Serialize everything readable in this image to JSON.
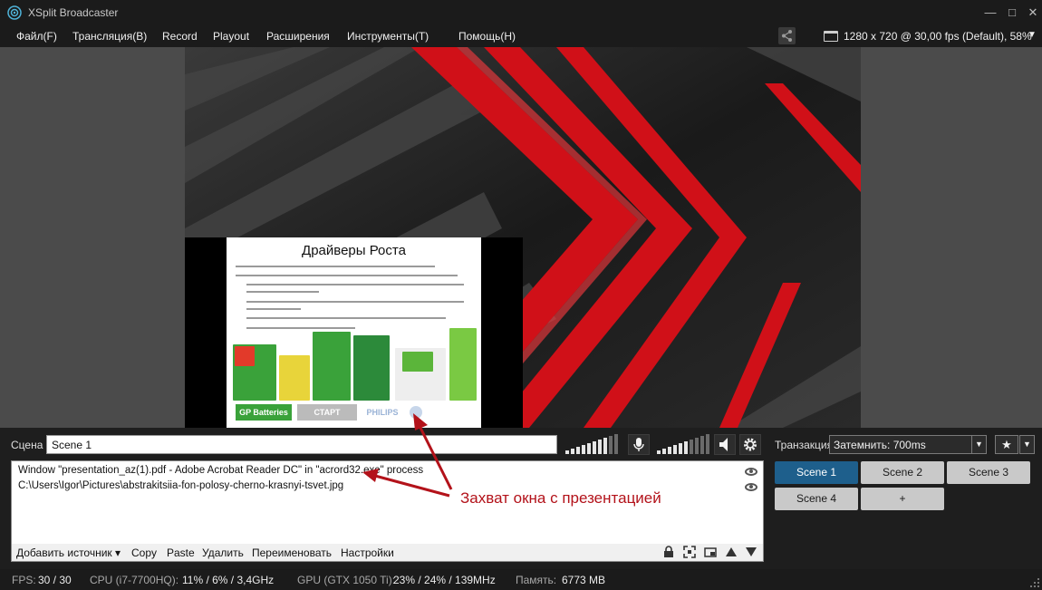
{
  "window": {
    "title": "XSplit Broadcaster",
    "minimize": "—",
    "maximize": "□",
    "close": "✕"
  },
  "menu": {
    "items": [
      "Файл(F)",
      "Трансляция(B)",
      "Record",
      "Playout",
      "Расширения",
      "Инструменты(T)",
      "Помощь(H)"
    ],
    "resolution": "1280 x 720 @ 30,00 fps (Default), 58%"
  },
  "slide": {
    "title": "Драйверы Роста",
    "logos": [
      "GP Batteries",
      "СТАРТ",
      "PHILIPS"
    ]
  },
  "scene": {
    "label": "Сцена",
    "name": "Scene 1"
  },
  "sources": [
    {
      "text": "Window \"presentation_az(1).pdf - Adobe Acrobat Reader DC\" in \"acrord32.exe\" process"
    },
    {
      "text": "C:\\Users\\Igor\\Pictures\\abstrakitsiia-fon-polosy-cherno-krasnyi-tsvet.jpg"
    }
  ],
  "source_toolbar": {
    "add_source": "Добавить источник ▾",
    "copy": "Copy",
    "paste": "Paste",
    "delete": "Удалить",
    "rename": "Переименовать",
    "settings": "Настройки"
  },
  "transition": {
    "label": "Транзакция",
    "value": "Затемнить: 700ms"
  },
  "scenes": [
    {
      "label": "Scene 1",
      "active": true
    },
    {
      "label": "Scene 2",
      "active": false
    },
    {
      "label": "Scene 3",
      "active": false
    },
    {
      "label": "Scene 4",
      "active": false
    },
    {
      "label": "+",
      "active": false
    }
  ],
  "status": {
    "fps_key": "FPS:",
    "fps_val": "30 / 30",
    "cpu_key": "CPU (i7-7700HQ):",
    "cpu_val": "11% / 6% / 3,4GHz",
    "gpu_key": "GPU (GTX 1050 Ti):",
    "gpu_val": "23% / 24% / 139MHz",
    "mem_key": "Память:",
    "mem_val": "6773 MB"
  },
  "annotation": {
    "text": "Захват окна с презентацией",
    "color": "#b3121a"
  },
  "colors": {
    "accent": "#1e5f8c",
    "background": "#1e1e1e"
  }
}
